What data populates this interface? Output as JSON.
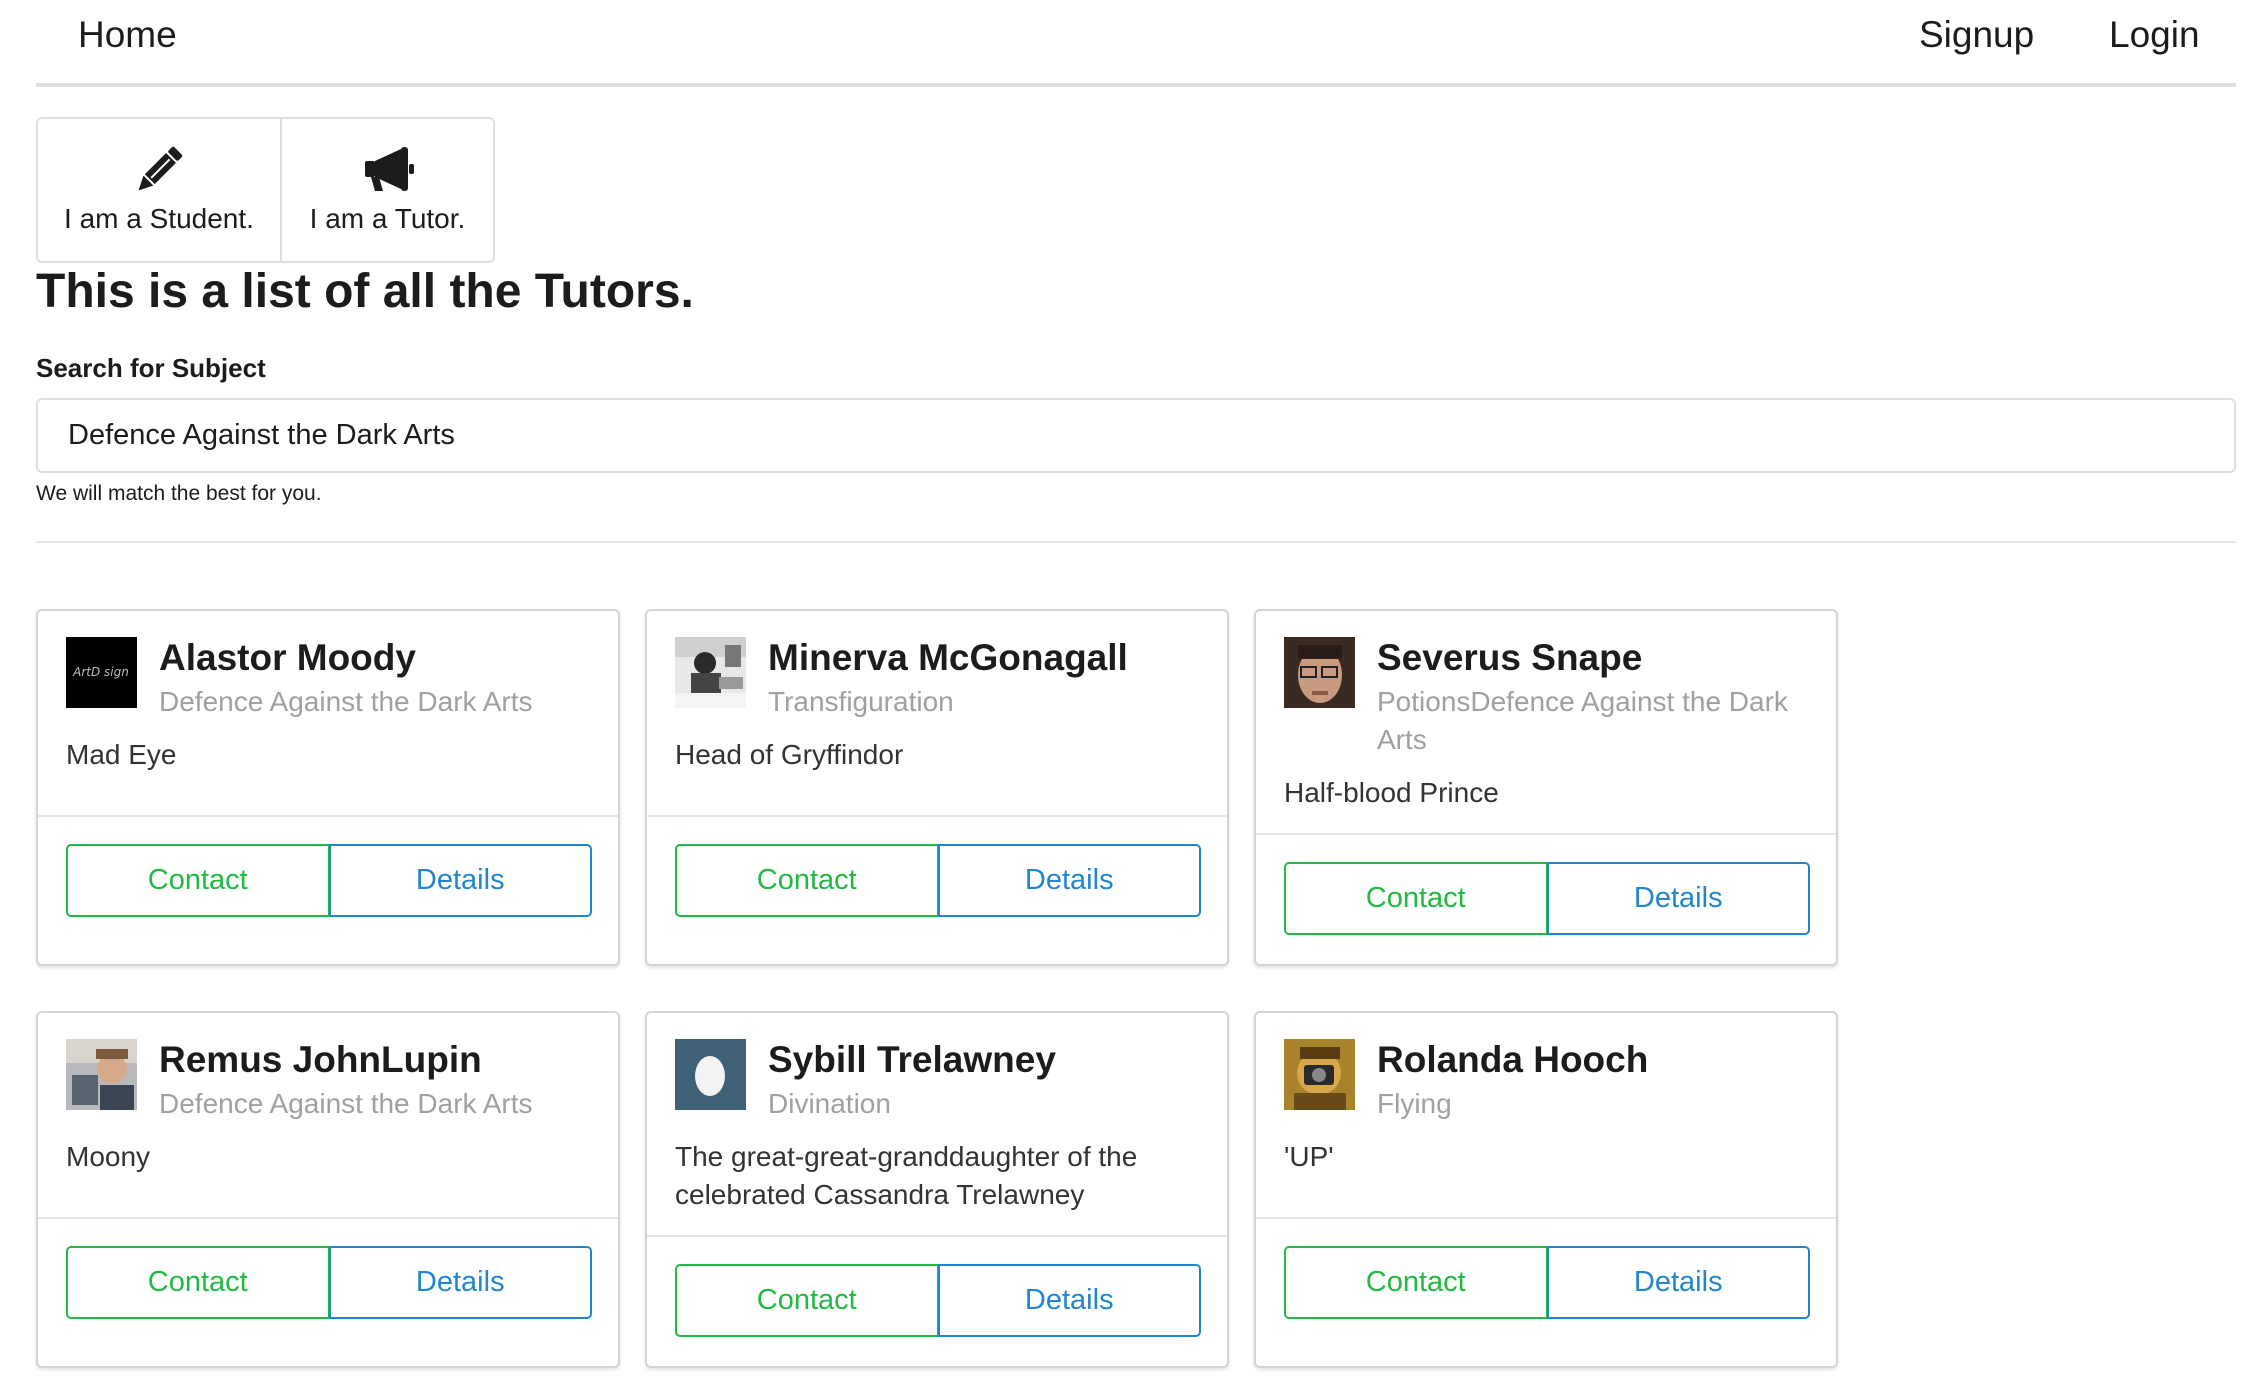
{
  "nav": {
    "home": "Home",
    "signup": "Signup",
    "login": "Login"
  },
  "roles": {
    "student": {
      "label": "I am a Student.",
      "icon": "pencil-icon"
    },
    "tutor": {
      "label": "I am a Tutor.",
      "icon": "bullhorn-icon"
    }
  },
  "main": {
    "title": "This is a list of all the Tutors."
  },
  "search": {
    "label": "Search for Subject",
    "value": "Defence Against the Dark Arts",
    "help": "We will match the best for you."
  },
  "tutors": [
    {
      "name": "Alastor Moody",
      "subject": "Defence Against the Dark Arts",
      "description": "Mad Eye",
      "avatar": "artdesign-logo-avatar",
      "contact_label": "Contact",
      "details_label": "Details"
    },
    {
      "name": "Minerva McGonagall",
      "subject": "Transfiguration",
      "description": "Head of Gryffindor",
      "avatar": "bw-photo-avatar",
      "contact_label": "Contact",
      "details_label": "Details"
    },
    {
      "name": "Severus Snape",
      "subject": "PotionsDefence Against the Dark Arts",
      "description": "Half-blood Prince",
      "avatar": "glasses-man-avatar",
      "contact_label": "Contact",
      "details_label": "Details"
    },
    {
      "name": "Remus JohnLupin",
      "subject": "Defence Against the Dark Arts",
      "description": "Moony",
      "avatar": "man-photo-avatar",
      "contact_label": "Contact",
      "details_label": "Details"
    },
    {
      "name": "Sybill Trelawney",
      "subject": "Divination",
      "description": "The great-great-granddaughter of the celebrated Cassandra Trelawney",
      "avatar": "egg-avatar",
      "contact_label": "Contact",
      "details_label": "Details"
    },
    {
      "name": "Rolanda Hooch",
      "subject": "Flying",
      "description": "'UP'",
      "avatar": "camera-person-avatar",
      "contact_label": "Contact",
      "details_label": "Details"
    }
  ],
  "colors": {
    "contact": "#21ba45",
    "details": "#2185d0",
    "meta": "#a0a0a0"
  }
}
